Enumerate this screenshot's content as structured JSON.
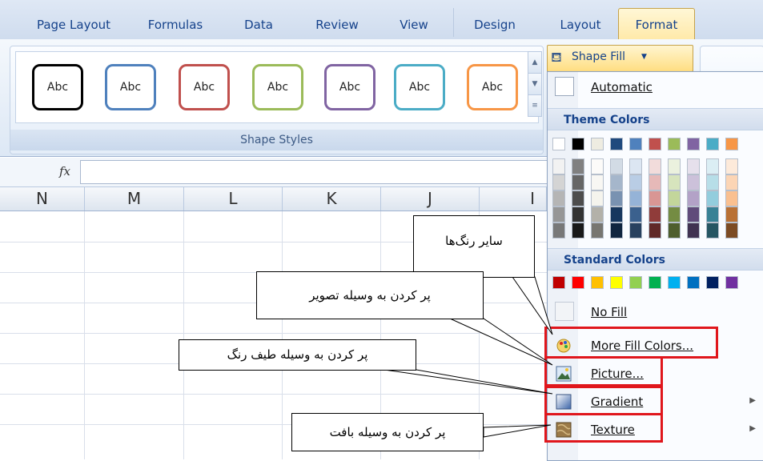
{
  "tabs": [
    {
      "label": "Page Layout"
    },
    {
      "label": "Formulas"
    },
    {
      "label": "Data"
    },
    {
      "label": "Review"
    },
    {
      "label": "View"
    },
    {
      "label": "Design"
    },
    {
      "label": "Layout"
    },
    {
      "label": "Format",
      "active": true
    }
  ],
  "shape_styles": {
    "items": [
      {
        "label": "Abc",
        "color": "#000000"
      },
      {
        "label": "Abc",
        "color": "#4f81bd"
      },
      {
        "label": "Abc",
        "color": "#c0504d"
      },
      {
        "label": "Abc",
        "color": "#9bbb59"
      },
      {
        "label": "Abc",
        "color": "#8064a2"
      },
      {
        "label": "Abc",
        "color": "#4bacc6"
      },
      {
        "label": "Abc",
        "color": "#f79646"
      }
    ],
    "group_label": "Shape Styles"
  },
  "formula_bar": {
    "fx": "fx"
  },
  "columns": [
    "N",
    "M",
    "L",
    "K",
    "J",
    "I"
  ],
  "shape_fill": {
    "label": "Shape Fill",
    "automatic": "Automatic",
    "theme_header": "Theme Colors",
    "standard_header": "Standard Colors",
    "theme_top": [
      "#ffffff",
      "#000000",
      "#eeece1",
      "#1f497d",
      "#4f81bd",
      "#c0504d",
      "#9bbb59",
      "#8064a2",
      "#4bacc6",
      "#f79646"
    ],
    "standard": [
      "#c00000",
      "#ff0000",
      "#ffc000",
      "#ffff00",
      "#92d050",
      "#00b050",
      "#00b0f0",
      "#0070c0",
      "#002060",
      "#7030a0"
    ],
    "no_fill": "No Fill",
    "more_colors": "More Fill Colors...",
    "picture": "Picture...",
    "gradient": "Gradient",
    "texture": "Texture"
  },
  "callouts": {
    "more_colors": "سایر رنگ‌ها",
    "picture": "پر کردن به وسیله تصویر",
    "gradient": "پر کردن به وسیله طیف رنگ",
    "texture": "پر کردن به وسیله بافت"
  }
}
